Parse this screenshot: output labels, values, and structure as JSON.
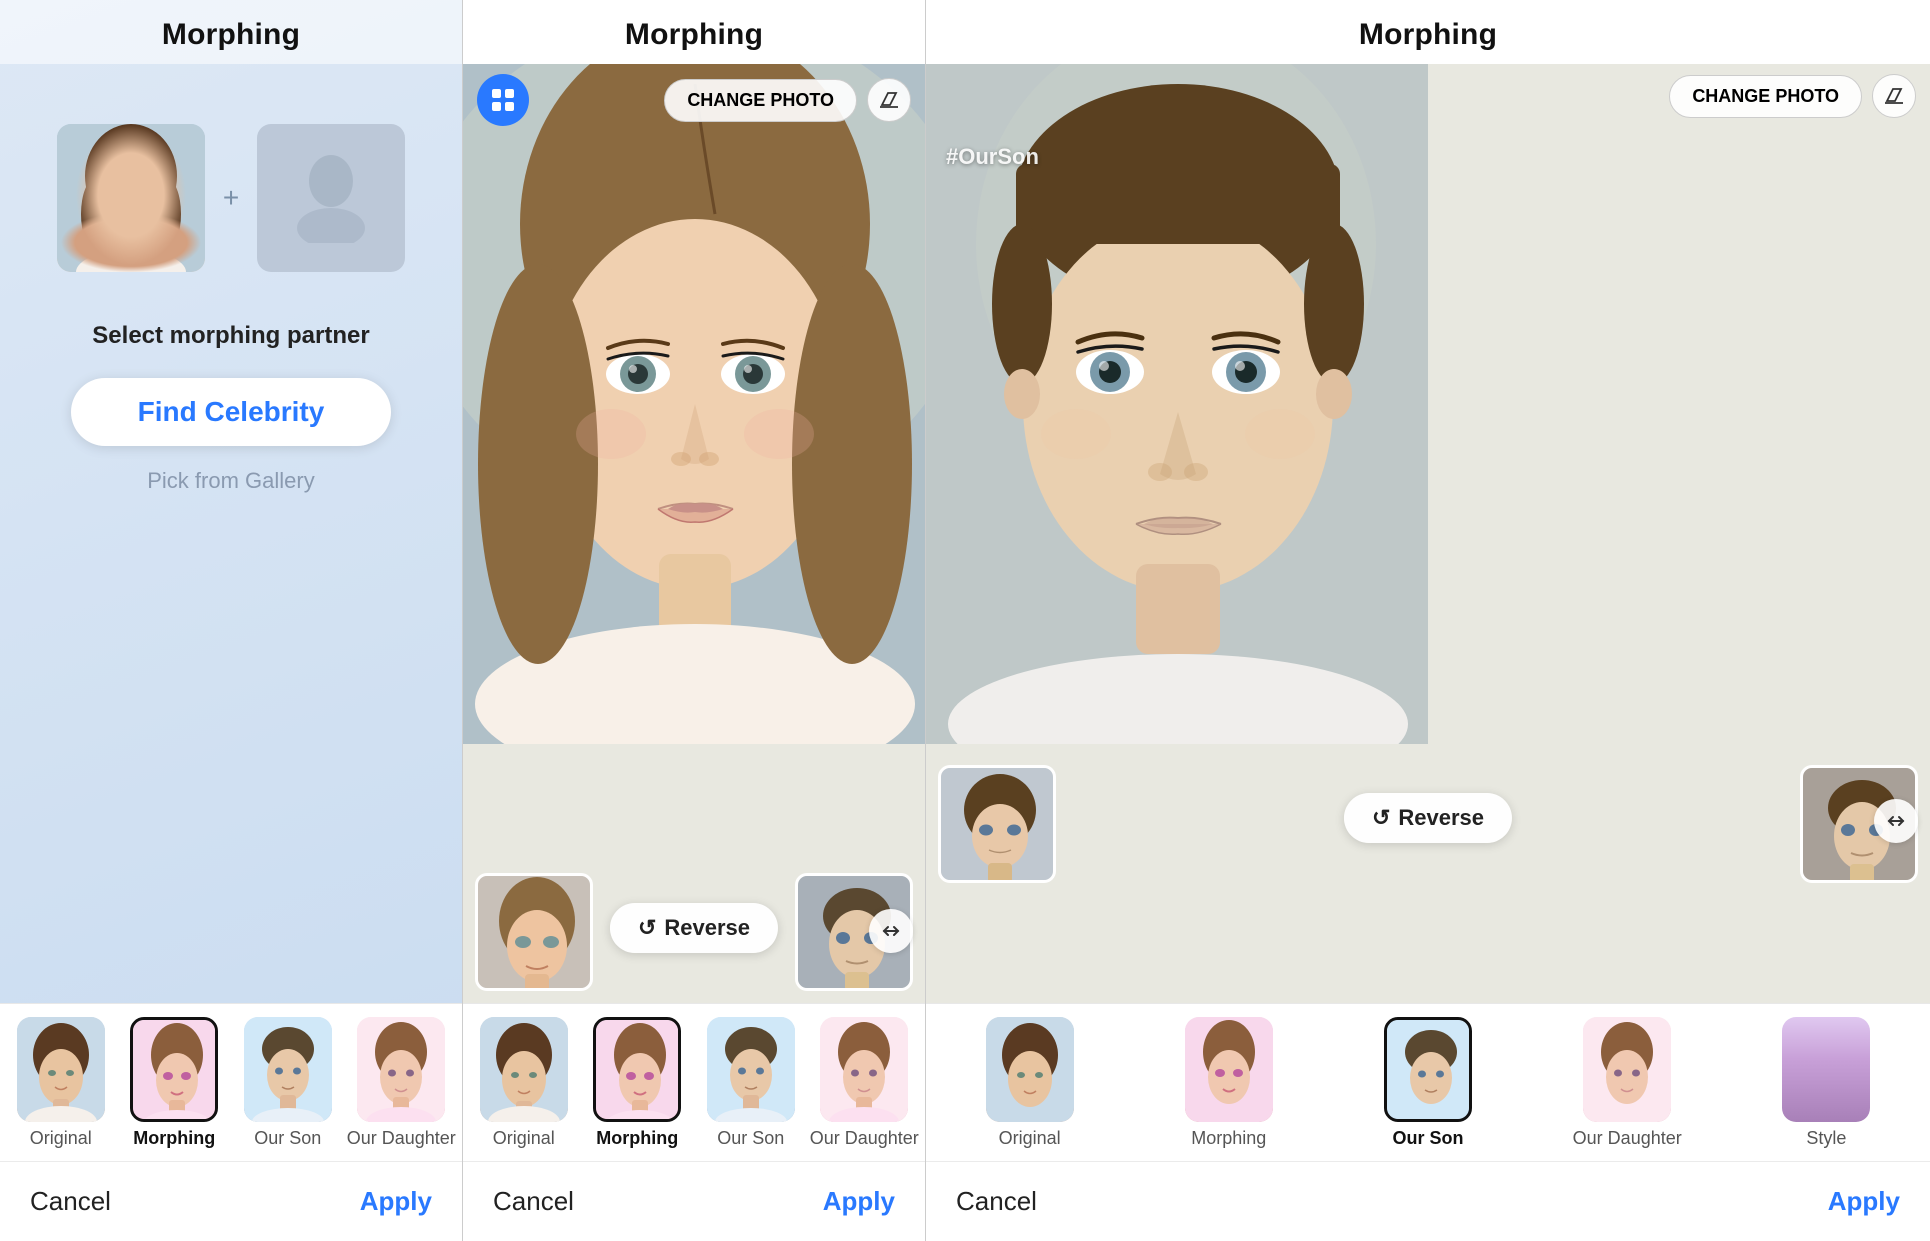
{
  "panel1": {
    "title": "Morphing",
    "select_label": "Select morphing partner",
    "find_celebrity": "Find Celebrity",
    "pick_gallery": "Pick from Gallery",
    "cancel": "Cancel",
    "apply": "Apply",
    "tabs": [
      {
        "label": "Original",
        "active": false,
        "thumb_class": "thumb-original"
      },
      {
        "label": "Morphing",
        "active": true,
        "thumb_class": "thumb-morphing-p1"
      },
      {
        "label": "Our Son",
        "active": false,
        "thumb_class": "thumb-ourson-p1"
      },
      {
        "label": "Our Daughter",
        "active": false,
        "thumb_class": "thumb-ourdaughter-p1"
      }
    ]
  },
  "panel2": {
    "title": "Morphing",
    "change_photo": "CHANGE PHOTO",
    "reverse_label": "Reverse",
    "cancel": "Cancel",
    "apply": "Apply",
    "tabs": [
      {
        "label": "Original",
        "active": false
      },
      {
        "label": "Morphing",
        "active": true
      },
      {
        "label": "Our Son",
        "active": false
      },
      {
        "label": "Our Daughter",
        "active": false
      }
    ]
  },
  "panel3_left": {
    "title": "Morphing",
    "change_photo": "CHANGE PHOTO",
    "hashtag": "#OurSon",
    "reverse_label": "Reverse",
    "cancel": "Cancel",
    "apply": "Apply",
    "tabs": [
      {
        "label": "Original",
        "active": false
      },
      {
        "label": "Morphing",
        "active": false
      },
      {
        "label": "Our Son",
        "active": true
      },
      {
        "label": "Our Daughter",
        "active": false
      },
      {
        "label": "Style",
        "active": false
      }
    ]
  },
  "icons": {
    "grid": "⊞",
    "erase": "◇",
    "reverse": "↺",
    "expand": "⟺"
  },
  "colors": {
    "blue": "#2979ff",
    "text_dark": "#111111",
    "text_grey": "#8a9ab0",
    "cancel": "#222222",
    "apply_blue": "#2979ff"
  }
}
